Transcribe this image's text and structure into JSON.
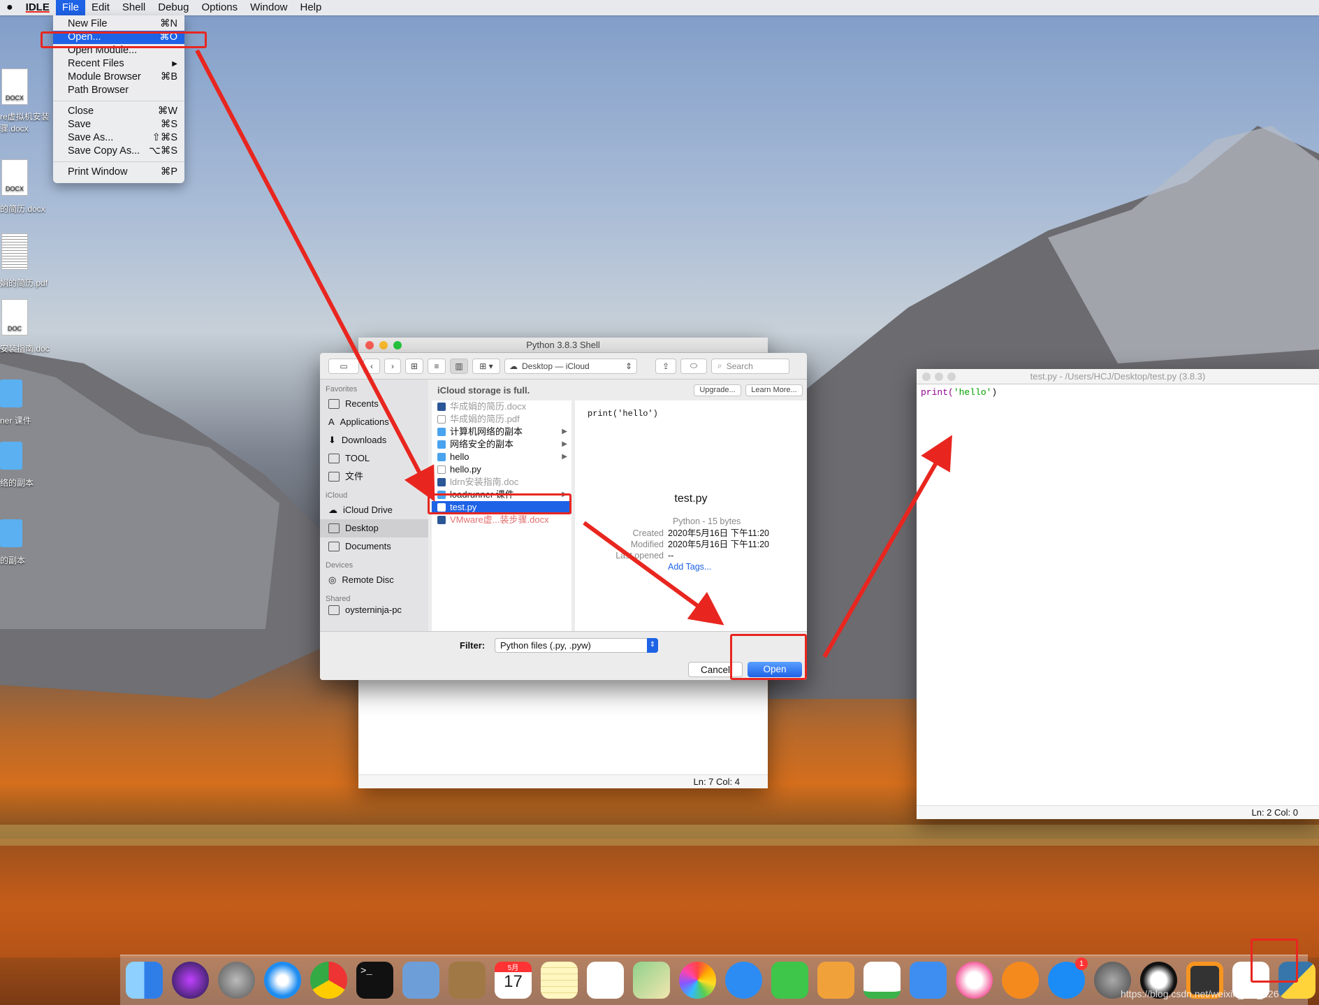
{
  "menubar": {
    "apple": "",
    "app": "IDLE",
    "items": [
      "File",
      "Edit",
      "Shell",
      "Debug",
      "Options",
      "Window",
      "Help"
    ]
  },
  "file_menu": {
    "items": [
      {
        "label": "New File",
        "shortcut": "⌘N"
      },
      {
        "label": "Open...",
        "shortcut": "⌘O"
      },
      {
        "label": "Open Module...",
        "shortcut": ""
      },
      {
        "label": "Recent Files",
        "shortcut": "▶"
      },
      {
        "label": "Module Browser",
        "shortcut": "⌘B"
      },
      {
        "label": "Path Browser",
        "shortcut": ""
      },
      {
        "label": "Close",
        "shortcut": "⌘W"
      },
      {
        "label": "Save",
        "shortcut": "⌘S"
      },
      {
        "label": "Save As...",
        "shortcut": "⇧⌘S"
      },
      {
        "label": "Save Copy As...",
        "shortcut": "⌥⌘S"
      },
      {
        "label": "Print Window",
        "shortcut": "⌘P"
      }
    ]
  },
  "desktop_icons": [
    {
      "label": "re虚拟机安装\n骤.docx",
      "badge": "DOCX"
    },
    {
      "label": "的简历.docx",
      "badge": "DOCX"
    },
    {
      "label": "娟的简历.pdf",
      "badge": ""
    },
    {
      "label": "安装指南.doc",
      "badge": "DOC"
    },
    {
      "label": "ner 课件",
      "badge": ""
    },
    {
      "label": "络的副本",
      "badge": ""
    },
    {
      "label": "的副本",
      "badge": ""
    }
  ],
  "shell_window": {
    "title": "Python 3.8.3 Shell",
    "status": "Ln: 7    Col: 4"
  },
  "editor_window": {
    "title": "test.py - /Users/HCJ/Desktop/test.py (3.8.3)",
    "code_fn": "print(",
    "code_str": "'hello'",
    "code_end": ")",
    "status": "Ln: 2    Col: 0"
  },
  "dialog": {
    "location": "Desktop — iCloud",
    "search_placeholder": "Search",
    "banner": "iCloud storage is full.",
    "upgrade": "Upgrade...",
    "learn_more": "Learn More...",
    "sidebar": {
      "favorites_header": "Favorites",
      "favorites": [
        "Recents",
        "Applications",
        "Downloads",
        "TOOL",
        "文件"
      ],
      "icloud_header": "iCloud",
      "icloud": [
        "iCloud Drive",
        "Desktop",
        "Documents"
      ],
      "devices_header": "Devices",
      "devices": [
        "Remote Disc"
      ],
      "shared_header": "Shared",
      "shared": [
        "oysterninja-pc"
      ]
    },
    "files": [
      {
        "name": "华成娟的简历.docx",
        "kind": "doc",
        "grey": true
      },
      {
        "name": "华成娟的简历.pdf",
        "kind": "pdf",
        "grey": true
      },
      {
        "name": "计算机网络的副本",
        "kind": "folder",
        "grey": false
      },
      {
        "name": "网络安全的副本",
        "kind": "folder",
        "grey": false
      },
      {
        "name": "hello",
        "kind": "folder",
        "grey": false
      },
      {
        "name": "hello.py",
        "kind": "py",
        "grey": false
      },
      {
        "name": "ldrn安装指南.doc",
        "kind": "doc",
        "grey": true
      },
      {
        "name": "loadrunner 课件",
        "kind": "folder",
        "grey": false
      },
      {
        "name": "test.py",
        "kind": "py",
        "grey": false
      },
      {
        "name": "VMware虚...装步骤.docx",
        "kind": "doc",
        "grey": true
      }
    ],
    "preview_code": "print('hello')",
    "preview_name": "test.py",
    "preview_kind": "Python - 15 bytes",
    "created_label": "Created",
    "created": "2020年5月16日 下午11:20",
    "modified_label": "Modified",
    "modified": "2020年5月16日 下午11:20",
    "last_opened_label": "Last opened",
    "last_opened": "--",
    "add_tags": "Add Tags...",
    "filter_label": "Filter:",
    "filter_value": "Python files (.py, .pyw)",
    "cancel": "Cancel",
    "open": "Open"
  },
  "dock": {
    "calendar_month": "5月",
    "calendar_day": "17",
    "notification_badge": "1"
  },
  "watermark": "https://blog.csdn.net/weixin_4..._226",
  "colors": {
    "accent": "#1e62e6",
    "annotation": "#e8261f"
  }
}
